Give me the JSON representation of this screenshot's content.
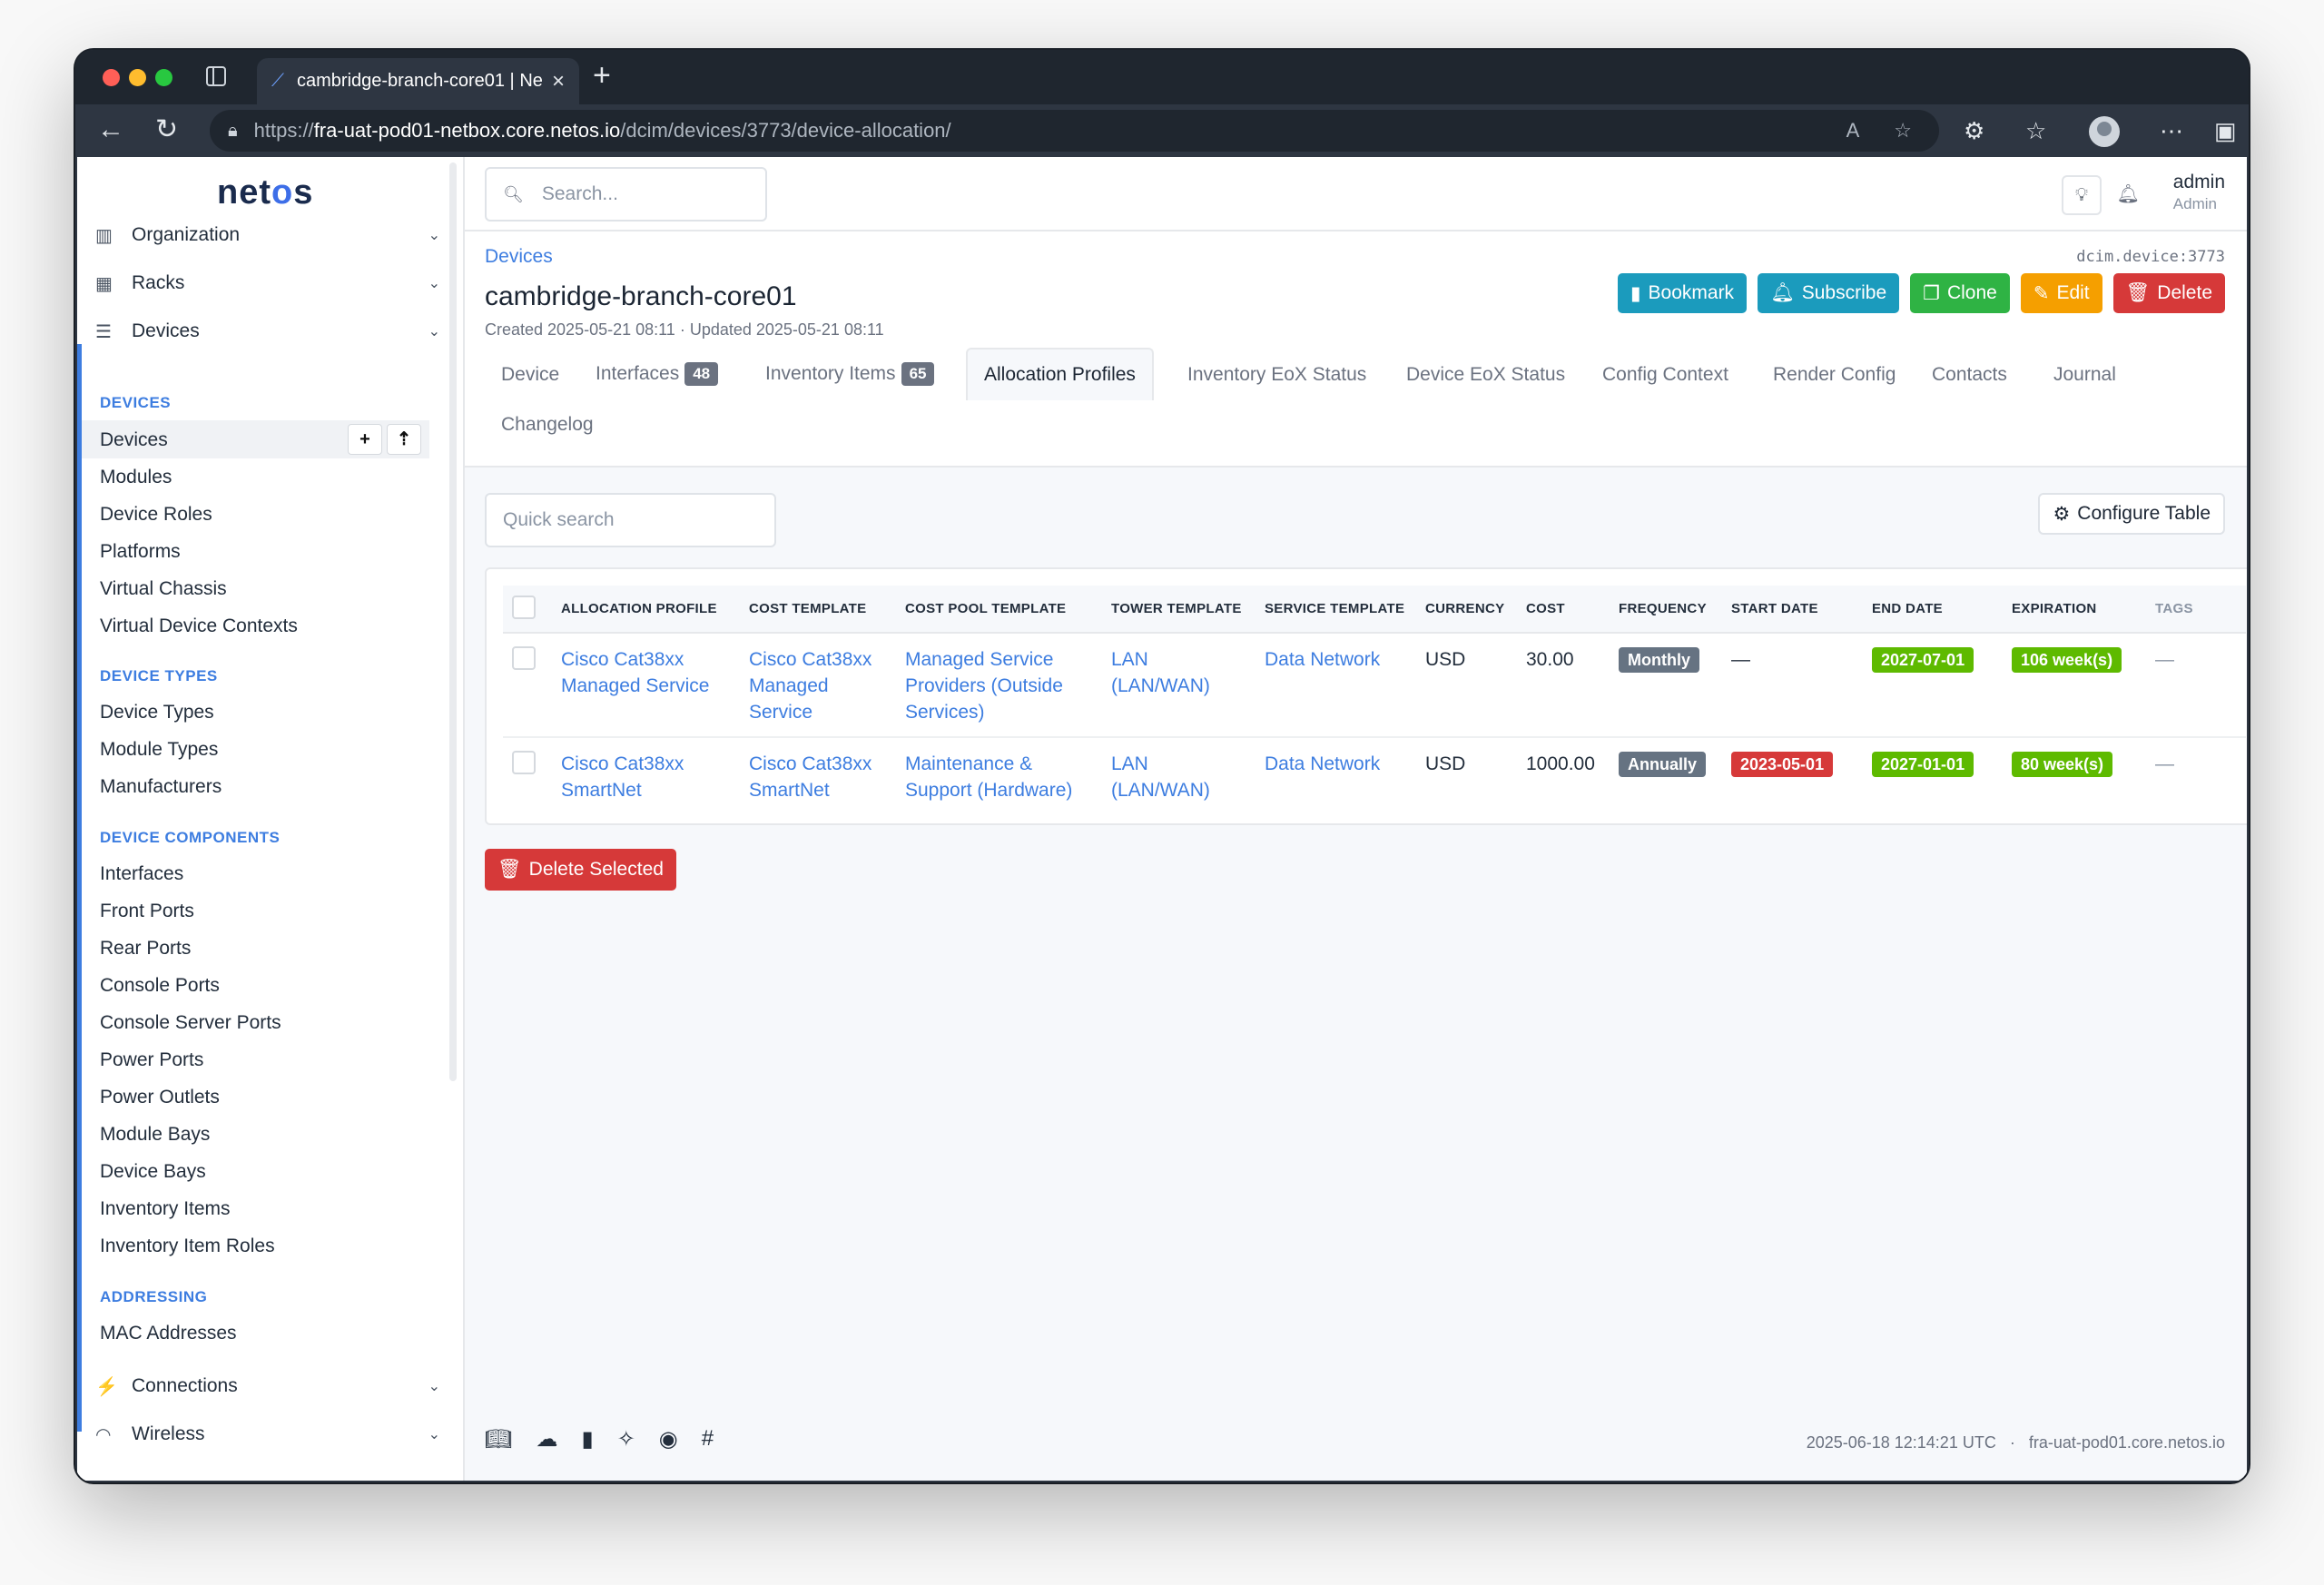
{
  "browser": {
    "tab_title": "cambridge-branch-core01 | Ne",
    "url_protocol": "https://",
    "url_host": "fra-uat-pod01-netbox.core.netos.io",
    "url_path": "/dcim/devices/3773/device-allocation/"
  },
  "sidebar": {
    "logo_left": "net",
    "logo_mid": "o",
    "logo_right": "s",
    "sections": [
      {
        "label": "Organization",
        "icon": "building-icon"
      },
      {
        "label": "Racks",
        "icon": "rack-icon"
      },
      {
        "label": "Devices",
        "icon": "server-icon"
      }
    ],
    "groups": {
      "devices": "DEVICES",
      "device_types": "DEVICE TYPES",
      "device_components": "DEVICE COMPONENTS",
      "addressing": "ADDRESSING"
    },
    "devices_items": [
      "Devices",
      "Modules",
      "Device Roles",
      "Platforms",
      "Virtual Chassis",
      "Virtual Device Contexts"
    ],
    "device_types_items": [
      "Device Types",
      "Module Types",
      "Manufacturers"
    ],
    "components_items": [
      "Interfaces",
      "Front Ports",
      "Rear Ports",
      "Console Ports",
      "Console Server Ports",
      "Power Ports",
      "Power Outlets",
      "Module Bays",
      "Device Bays",
      "Inventory Items",
      "Inventory Item Roles"
    ],
    "addressing_items": [
      "MAC Addresses"
    ],
    "bottom_sections": [
      {
        "label": "Connections",
        "icon": "plug-icon"
      },
      {
        "label": "Wireless",
        "icon": "wifi-icon"
      }
    ]
  },
  "topbar": {
    "search_placeholder": "Search...",
    "user_name": "admin",
    "user_role": "Admin"
  },
  "header": {
    "breadcrumb": "Devices",
    "object_id": "dcim.device:3773",
    "title": "cambridge-branch-core01",
    "meta": "Created 2025-05-21 08:11 · Updated 2025-05-21 08:11",
    "buttons": {
      "bookmark": "Bookmark",
      "subscribe": "Subscribe",
      "clone": "Clone",
      "edit": "Edit",
      "delete": "Delete"
    },
    "colors": {
      "bookmark": "#1b9bbd",
      "subscribe": "#1b9bbd",
      "clone": "#2fb344",
      "edit": "#f59f00",
      "delete": "#d63939"
    }
  },
  "tabs": {
    "device": "Device",
    "interfaces": "Interfaces",
    "interfaces_count": "48",
    "inventory": "Inventory Items",
    "inventory_count": "65",
    "allocation": "Allocation Profiles",
    "inventory_eox": "Inventory EoX Status",
    "device_eox": "Device EoX Status",
    "config_context": "Config Context",
    "render_config": "Render Config",
    "contacts": "Contacts",
    "journal": "Journal",
    "changelog": "Changelog"
  },
  "table": {
    "quick_search": "Quick search",
    "configure": "Configure Table",
    "headers": [
      "ALLOCATION PROFILE",
      "COST TEMPLATE",
      "COST POOL TEMPLATE",
      "TOWER TEMPLATE",
      "SERVICE TEMPLATE",
      "CURRENCY",
      "COST",
      "FREQUENCY",
      "START DATE",
      "END DATE",
      "EXPIRATION",
      "TAGS"
    ],
    "rows": [
      {
        "profile": "Cisco Cat38xx Managed Service",
        "cost_template": "Cisco Cat38xx Managed Service",
        "pool_template": "Managed Service Providers (Outside Services)",
        "tower": "LAN (LAN/WAN)",
        "service": "Data Network",
        "currency": "USD",
        "cost": "30.00",
        "frequency": "Monthly",
        "start_date": "—",
        "end_date": "2027-07-01",
        "expiration": "106 week(s)",
        "tags": "—"
      },
      {
        "profile": "Cisco Cat38xx SmartNet",
        "cost_template": "Cisco Cat38xx SmartNet",
        "pool_template": "Maintenance & Support (Hardware)",
        "tower": "LAN (LAN/WAN)",
        "service": "Data Network",
        "currency": "USD",
        "cost": "1000.00",
        "frequency": "Annually",
        "start_date": "2023-05-01",
        "end_date": "2027-01-01",
        "expiration": "80 week(s)",
        "tags": "—"
      }
    ],
    "delete_selected": "Delete Selected",
    "badge_colors": {
      "gray": "#667382",
      "red": "#d63939",
      "green": "#5eba00"
    }
  },
  "footer": {
    "timestamp": "2025-06-18 12:14:21 UTC",
    "separator": "·",
    "hostname": "fra-uat-pod01.core.netos.io"
  }
}
